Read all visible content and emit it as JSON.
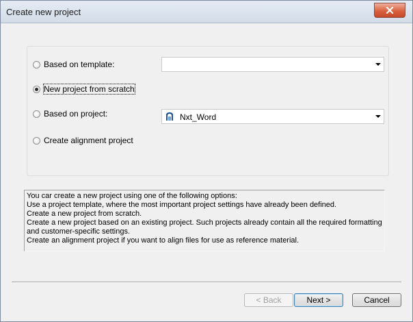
{
  "window": {
    "title": "Create new project",
    "close_icon": "close-icon"
  },
  "options": [
    {
      "label": "Based on template:",
      "checked": false
    },
    {
      "label": "New project from scratch",
      "checked": true
    },
    {
      "label": "Based on project:",
      "checked": false
    },
    {
      "label": "Create alignment project",
      "checked": false
    }
  ],
  "template_combo": {
    "value": ""
  },
  "project_combo": {
    "value": "Nxt_Word",
    "icon": "project-icon"
  },
  "description": {
    "lines": [
      "You car create a new project using one of the following options:",
      "Use a project template, where the most important project settings have already been defined.",
      "Create a new project from scratch.",
      "Create a new project based on an existing project. Such projects already contain all the required formatting and customer-specific settings.",
      "Create an alignment project if you want to align files for use as reference material."
    ]
  },
  "buttons": {
    "back": "< Back",
    "next": "Next >",
    "cancel": "Cancel"
  },
  "colors": {
    "close_button": "#d9613f",
    "dialog_bg": "#f0f0f0",
    "default_button_border": "#3c7fb1"
  }
}
